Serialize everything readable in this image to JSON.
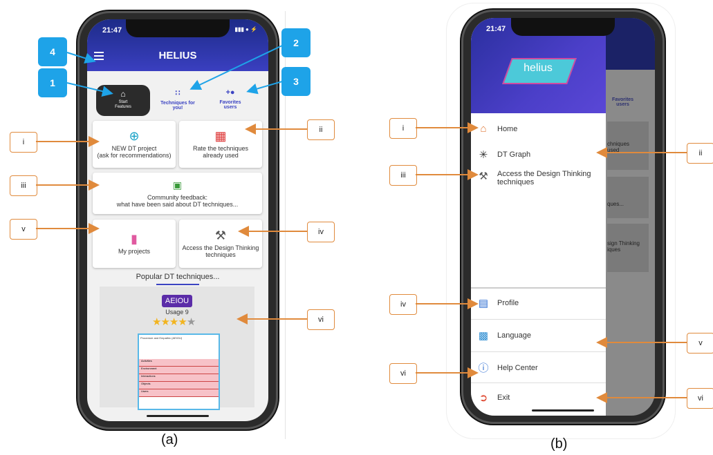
{
  "colors": {
    "accent": "#3b43c2",
    "badge": "#1ea3e8",
    "callout": "#e08a3c",
    "appbar": "#2a35a8"
  },
  "screen_a": {
    "time": "21:47",
    "status_icons": "▮▮▮ ● ⚡",
    "app_title": "HELIUS",
    "menu_icon": "hamburger-menu-icon",
    "tabs": [
      {
        "label": "Start\nFeatures",
        "icon": "home-icon",
        "selected": true
      },
      {
        "label": "Techniques for\nyou!",
        "icon": "grid-icon",
        "selected": false
      },
      {
        "label": "Favorites\nusers",
        "icon": "add-user-icon",
        "selected": false
      }
    ],
    "cards": {
      "new_project": "NEW DT project\n(ask for recommendations)",
      "rate": "Rate the techniques\nalready used",
      "community": "Community feedback:\nwhat have been said about DT techniques...",
      "my_projects": "My projects",
      "access": "Access the Design Thinking\ntechniques"
    },
    "popular_title": "Popular DT techniques...",
    "technique": {
      "name": "AEIOU",
      "usage": "Usage 9",
      "rating": 4,
      "max_rating": 5,
      "worksheet_title": "Procedure and Empathic (AEIOU)",
      "worksheet_rows": [
        "Activities",
        "Environment",
        "Interactions",
        "Objects",
        "Users"
      ]
    }
  },
  "screen_b": {
    "time": "21:47",
    "logo_text": "helius",
    "menu_items": [
      {
        "label": "Home",
        "icon": "home-icon"
      },
      {
        "label": "DT Graph",
        "icon": "graph-icon"
      },
      {
        "label": "Access the Design Thinking\ntechniques",
        "icon": "tools-icon"
      }
    ],
    "bottom_items": [
      {
        "label": "Profile",
        "icon": "profile-icon"
      },
      {
        "label": "Language",
        "icon": "language-icon"
      },
      {
        "label": "Help Center",
        "icon": "help-icon"
      },
      {
        "label": "Exit",
        "icon": "exit-icon"
      }
    ],
    "bg_fragments": {
      "fav": "Favorites\nusers",
      "tech": "chniques\nused",
      "ques": "ques...",
      "design": "sign Thinking\niques"
    }
  },
  "annotations_a": {
    "badges": [
      "4",
      "1",
      "2",
      "3"
    ],
    "left": [
      "i",
      "iii",
      "v"
    ],
    "right": [
      "ii",
      "iv",
      "vi"
    ]
  },
  "annotations_b": {
    "left": [
      "i",
      "iii",
      "iv",
      "vi"
    ],
    "right": [
      "ii",
      "v",
      "vi"
    ]
  },
  "captions": [
    "(a)",
    "(b)"
  ]
}
